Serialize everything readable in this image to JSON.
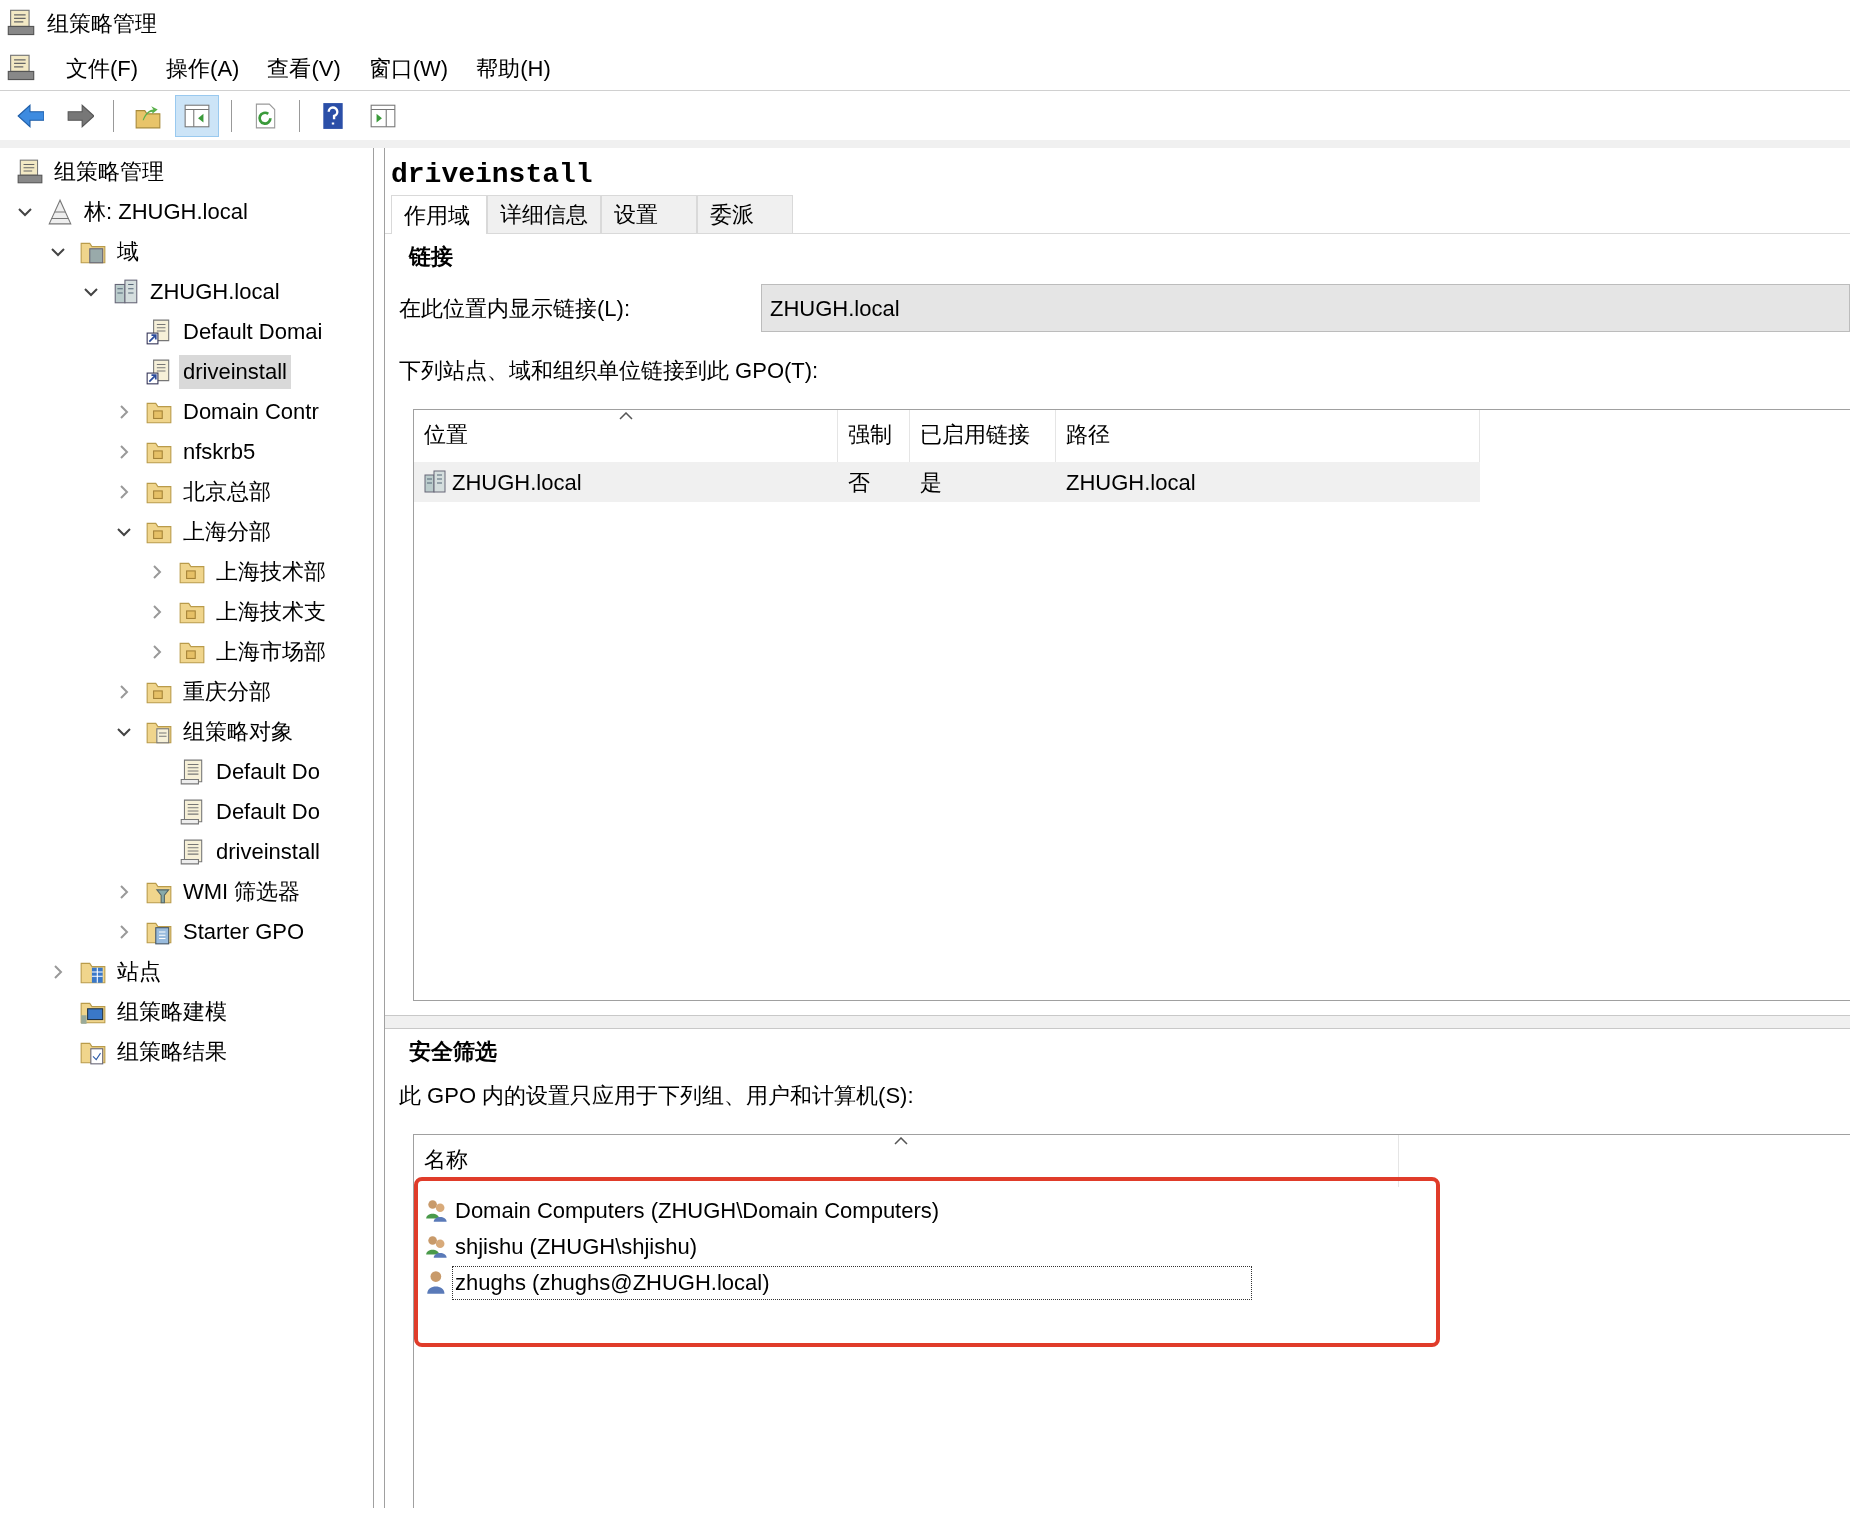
{
  "window": {
    "title": "组策略管理"
  },
  "menu": [
    "文件(F)",
    "操作(A)",
    "查看(V)",
    "窗口(W)",
    "帮助(H)"
  ],
  "toolbar": [
    {
      "kind": "back",
      "pressed": false
    },
    {
      "kind": "forward",
      "pressed": false
    },
    {
      "kind": "sep"
    },
    {
      "kind": "up",
      "pressed": false
    },
    {
      "kind": "tree",
      "pressed": true
    },
    {
      "kind": "sep"
    },
    {
      "kind": "refresh",
      "pressed": false
    },
    {
      "kind": "sep"
    },
    {
      "kind": "help",
      "pressed": false
    },
    {
      "kind": "pane",
      "pressed": false
    }
  ],
  "tree": [
    {
      "label": "组策略管理",
      "kind": "console",
      "selected": false,
      "children": [
        {
          "label": "林: ZHUGH.local",
          "kind": "forest",
          "expanded": true,
          "selected": false,
          "children": [
            {
              "label": "域",
              "kind": "domains",
              "expanded": true,
              "selected": false,
              "children": [
                {
                  "label": "ZHUGH.local",
                  "kind": "domain",
                  "expanded": true,
                  "selected": false,
                  "children": [
                    {
                      "label": "Default Domai",
                      "kind": "gpolink",
                      "selected": false
                    },
                    {
                      "label": "driveinstall",
                      "kind": "gpolink",
                      "selected": true
                    },
                    {
                      "label": "Domain Contr",
                      "kind": "ou",
                      "expanded": false,
                      "selected": false
                    },
                    {
                      "label": "nfskrb5",
                      "kind": "ou",
                      "expanded": false,
                      "selected": false
                    },
                    {
                      "label": "北京总部",
                      "kind": "ou",
                      "expanded": false,
                      "selected": false
                    },
                    {
                      "label": "上海分部",
                      "kind": "ou",
                      "expanded": true,
                      "selected": false,
                      "children": [
                        {
                          "label": "上海技术部",
                          "kind": "ou",
                          "expanded": false,
                          "selected": false
                        },
                        {
                          "label": "上海技术支",
                          "kind": "ou",
                          "expanded": false,
                          "selected": false
                        },
                        {
                          "label": "上海市场部",
                          "kind": "ou",
                          "expanded": false,
                          "selected": false
                        }
                      ]
                    },
                    {
                      "label": "重庆分部",
                      "kind": "ou",
                      "expanded": false,
                      "selected": false
                    },
                    {
                      "label": "组策略对象",
                      "kind": "gpofolder",
                      "expanded": true,
                      "selected": false,
                      "children": [
                        {
                          "label": "Default Do",
                          "kind": "gpo",
                          "selected": false
                        },
                        {
                          "label": "Default Do",
                          "kind": "gpo",
                          "selected": false
                        },
                        {
                          "label": "driveinstall",
                          "kind": "gpo",
                          "selected": false
                        }
                      ]
                    },
                    {
                      "label": "WMI 筛选器",
                      "kind": "wmi",
                      "expanded": false,
                      "selected": false
                    },
                    {
                      "label": "Starter GPO",
                      "kind": "starter",
                      "expanded": false,
                      "selected": false
                    }
                  ]
                }
              ]
            },
            {
              "label": "站点",
              "kind": "sites",
              "expanded": false,
              "selected": false
            },
            {
              "label": "组策略建模",
              "kind": "modeling",
              "selected": false
            },
            {
              "label": "组策略结果",
              "kind": "results",
              "selected": false
            }
          ]
        }
      ]
    }
  ],
  "details": {
    "title": "driveinstall",
    "tabs": [
      {
        "label": "作用域",
        "selected": true
      },
      {
        "label": "详细信息",
        "selected": false
      },
      {
        "label": "设置",
        "selected": false
      },
      {
        "label": "委派",
        "selected": false
      }
    ],
    "links": {
      "heading": "链接",
      "location_label": "在此位置内显示链接(L):",
      "location_value": "ZHUGH.local",
      "table_label": "下列站点、域和组织单位链接到此 GPO(T):",
      "columns": [
        "位置",
        "强制",
        "已启用链接",
        "路径"
      ],
      "rows": [
        {
          "cells": [
            "ZHUGH.local",
            "否",
            "是",
            "ZHUGH.local"
          ],
          "selected": true
        }
      ]
    },
    "security": {
      "heading": "安全筛选",
      "label": "此 GPO 内的设置只应用于下列组、用户和计算机(S):",
      "columns": [
        "名称"
      ],
      "rows": [
        {
          "kind": "group",
          "name": "Domain Computers (ZHUGH\\Domain Computers)",
          "focused": false
        },
        {
          "kind": "group",
          "name": "shjishu (ZHUGH\\shjishu)",
          "focused": false
        },
        {
          "kind": "user",
          "name": "zhughs (zhughs@ZHUGH.local)",
          "focused": true
        }
      ]
    }
  }
}
